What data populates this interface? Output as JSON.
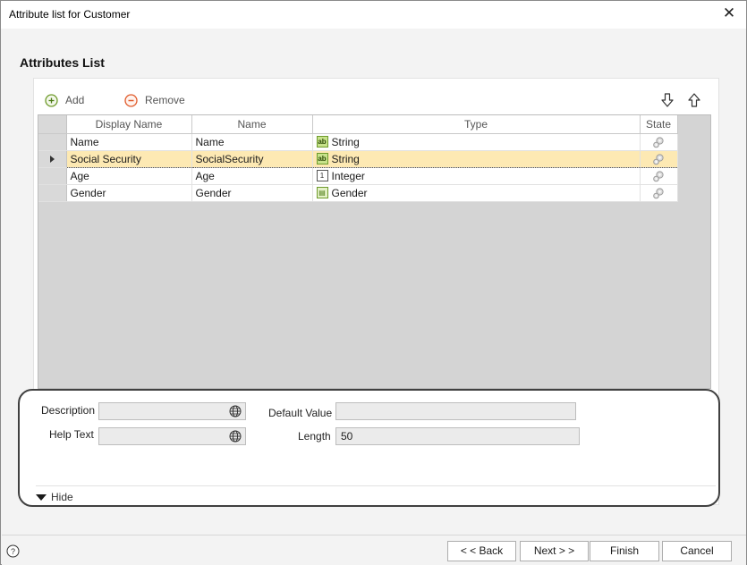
{
  "window": {
    "title": "Attribute list for Customer"
  },
  "heading": "Attributes List",
  "toolbar": {
    "add_label": "Add",
    "remove_label": "Remove"
  },
  "grid": {
    "columns": [
      "Display Name",
      "Name",
      "Type",
      "State"
    ],
    "rows": [
      {
        "display_name": "Name",
        "name": "Name",
        "type": "String",
        "type_icon": "string-type-icon",
        "state_icon": "gear-icon",
        "selected": false
      },
      {
        "display_name": "Social Security",
        "name": "SocialSecurity",
        "type": "String",
        "type_icon": "string-type-icon",
        "state_icon": "gear-icon",
        "selected": true
      },
      {
        "display_name": "Age",
        "name": "Age",
        "type": "Integer",
        "type_icon": "integer-type-icon",
        "state_icon": "gear-icon",
        "selected": false
      },
      {
        "display_name": "Gender",
        "name": "Gender",
        "type": "Gender",
        "type_icon": "enum-type-icon",
        "state_icon": "gear-icon",
        "selected": false
      }
    ]
  },
  "details": {
    "description_label": "Description",
    "description_value": "",
    "help_text_label": "Help Text",
    "help_text_value": "",
    "default_value_label": "Default Value",
    "default_value": "",
    "length_label": "Length",
    "length_value": "50",
    "hide_label": "Hide"
  },
  "footer": {
    "back_label": "< < Back",
    "next_label": "Next > >",
    "finish_label": "Finish",
    "cancel_label": "Cancel"
  },
  "colors": {
    "selected_row": "#fde9b3",
    "string_icon": "#c7e28b",
    "accent_remove": "#e05a2a",
    "accent_add": "#6e9b2b"
  }
}
